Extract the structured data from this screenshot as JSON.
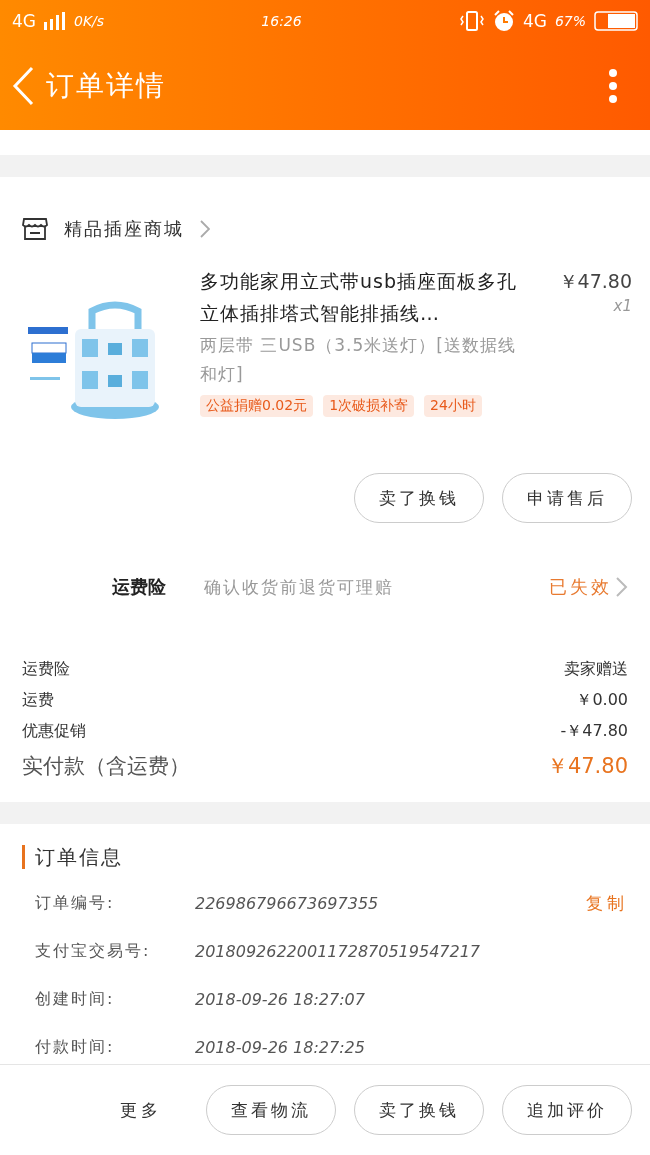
{
  "status_bar": {
    "network": "4G",
    "speed": "0K/s",
    "time": "16:26",
    "data": "4G",
    "battery": "67%"
  },
  "header": {
    "title": "订单详情"
  },
  "shop": {
    "name": "精品插座商城"
  },
  "product": {
    "kind": "picture",
    "title": "多功能家用立式带usb插座面板多孔立体插排塔式智能排插线…",
    "price": "￥47.80",
    "quantity": "x1",
    "spec": "两层带  三USB（3.5米送灯）[送数据线和灯]",
    "tags": [
      "公益捐赠0.02元",
      "1次破损补寄",
      "24小时"
    ]
  },
  "item_buttons": [
    "卖了换钱",
    "申请售后"
  ],
  "insurance": {
    "label": "运费险",
    "description": "确认收货前退货可理赔",
    "status": "已失效"
  },
  "costs": [
    {
      "label": "运费险",
      "value": "卖家赠送"
    },
    {
      "label": "运费",
      "value": "￥0.00"
    },
    {
      "label": "优惠促销",
      "value": "-￥47.80"
    }
  ],
  "total": {
    "label": "实付款（含运费）",
    "value": "￥47.80"
  },
  "order_info": {
    "title": "订单信息",
    "copy": "复制",
    "rows": [
      {
        "label": "订单编号:",
        "value": "226986796673697355"
      },
      {
        "label": "支付宝交易号:",
        "value": "2018092622001172870519547217"
      },
      {
        "label": "创建时间:",
        "value": "2018-09-26 18:27:07"
      },
      {
        "label": "付款时间:",
        "value": "2018-09-26 18:27:25"
      }
    ]
  },
  "bottom_bar": {
    "more": "更多",
    "buttons": [
      "查看物流",
      "卖了换钱",
      "追加评价"
    ]
  }
}
